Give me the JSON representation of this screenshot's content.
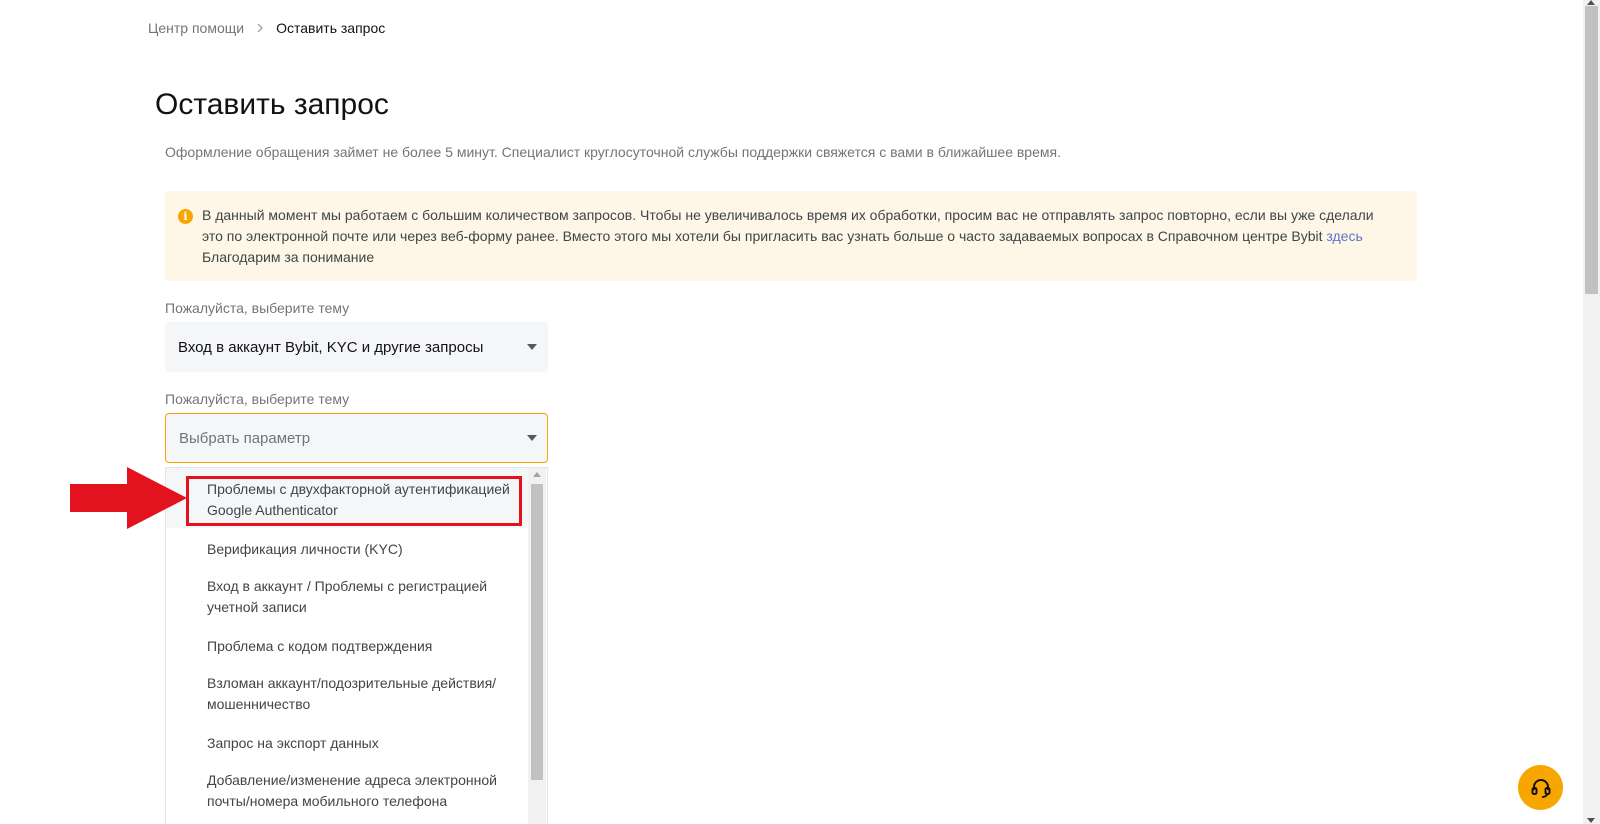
{
  "breadcrumb": {
    "home": "Центр помощи",
    "current": "Оставить запрос"
  },
  "page": {
    "title": "Оставить запрос",
    "subtitle": "Оформление обращения займет не более 5 минут. Специалист круглосуточной службы поддержки свяжется с вами в ближайшее время."
  },
  "notice": {
    "icon": "info-icon",
    "text_part1": "В данный момент мы работаем с большим количеством запросов. Чтобы не увеличивалось время их обработки, просим вас не отправлять запрос повторно, если вы уже сделали это по электронной почте или через веб-форму ранее. Вместо этого мы хотели бы пригласить вас узнать больше о часто задаваемых вопросах в Справочном центре Bybit ",
    "link": "здесь",
    "text_part2": "Благодарим за понимание"
  },
  "form": {
    "topic_label": "Пожалуйста, выберите тему",
    "topic_value": "Вход в аккаунт Bybit, KYC и другие запросы",
    "subtopic_label": "Пожалуйста, выберите тему",
    "subtopic_placeholder": "Выбрать параметр",
    "options": [
      {
        "label": "Проблемы с двухфакторной аутентификацией Google Authenticator",
        "highlighted": true
      },
      {
        "label": "Верификация личности (KYC)"
      },
      {
        "label": "Вход в аккаунт / Проблемы с регистрацией учетной записи"
      },
      {
        "label": "Проблема с кодом подтверждения"
      },
      {
        "label": "Взломан аккаунт/подозрительные действия/мошенничество"
      },
      {
        "label": "Запрос на экспорт данных"
      },
      {
        "label": "Добавление/изменение адреса электронной почты/номера мобильного телефона"
      }
    ]
  },
  "annotation": {
    "arrow_color": "#e3121f",
    "box_color": "#e3121f"
  },
  "colors": {
    "accent": "#f7a600",
    "notice_bg": "#fef6e6",
    "link": "#5f74c9"
  },
  "support": {
    "icon": "headset-icon"
  }
}
